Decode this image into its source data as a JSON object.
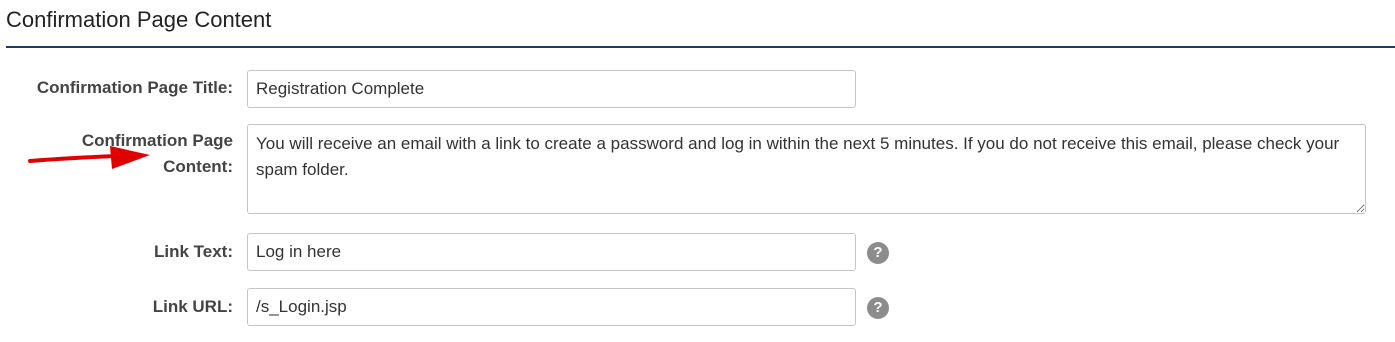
{
  "section": {
    "title": "Confirmation Page Content"
  },
  "form": {
    "title_label": "Confirmation Page Title:",
    "title_value": "Registration Complete",
    "content_label_line1": "Confirmation Page",
    "content_label_line2": "Content:",
    "content_value": "You will receive an email with a link to create a password and log in within the next 5 minutes. If you do not receive this email, please check your spam folder.",
    "link_text_label": "Link Text:",
    "link_text_value": "Log in here",
    "link_url_label": "Link URL:",
    "link_url_value": "/s_Login.jsp",
    "help_glyph": "?"
  },
  "icons": {
    "annotation_arrow": "red-arrow-icon",
    "help": "question-circle-icon"
  },
  "colors": {
    "rule": "#1f3864",
    "arrow": "#e00000",
    "help_badge": "#8c8c8c"
  }
}
